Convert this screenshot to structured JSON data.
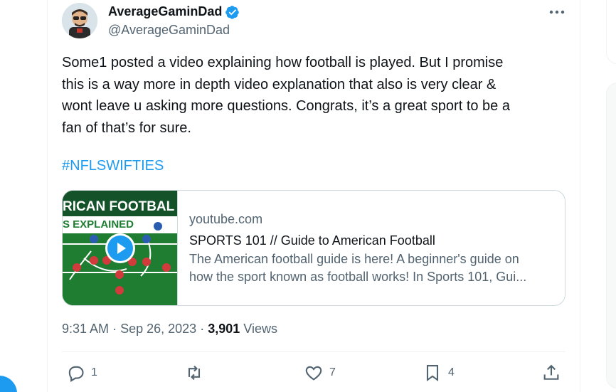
{
  "author": {
    "display_name": "AverageGaminDad",
    "handle": "@AverageGaminDad",
    "verified": true
  },
  "tweet": {
    "text": "Some1 posted a video explaining how football is played. But I promise\nthis is a way more in depth video explanation that also is very clear &\nwont leave u asking more questions. Congrats, it’s a great sport to be a\nfan of that’s for sure.",
    "hashtag": "#NFLSWIFTIES"
  },
  "link_card": {
    "thumb_title_line1": "RICAN FOOTBAL",
    "thumb_title_line2": "S EXPLAINED",
    "domain": "youtube.com",
    "title": "SPORTS 101 // Guide to American Football",
    "description_line1": "The American football guide is here! A beginner's guide on",
    "description_line2": "how the sport known as football works! In Sports 101, Gui..."
  },
  "meta": {
    "time": "9:31 AM",
    "sep1": "·",
    "date": "Sep 26, 2023",
    "sep2": "·",
    "views_count": "3,901",
    "views_label": "Views"
  },
  "actions": {
    "reply_count": "1",
    "retweet_count": "",
    "like_count": "7",
    "bookmark_count": "4"
  },
  "colors": {
    "accent": "#1d9bf0",
    "secondary_text": "#536471",
    "primary_text": "#0f1419"
  }
}
